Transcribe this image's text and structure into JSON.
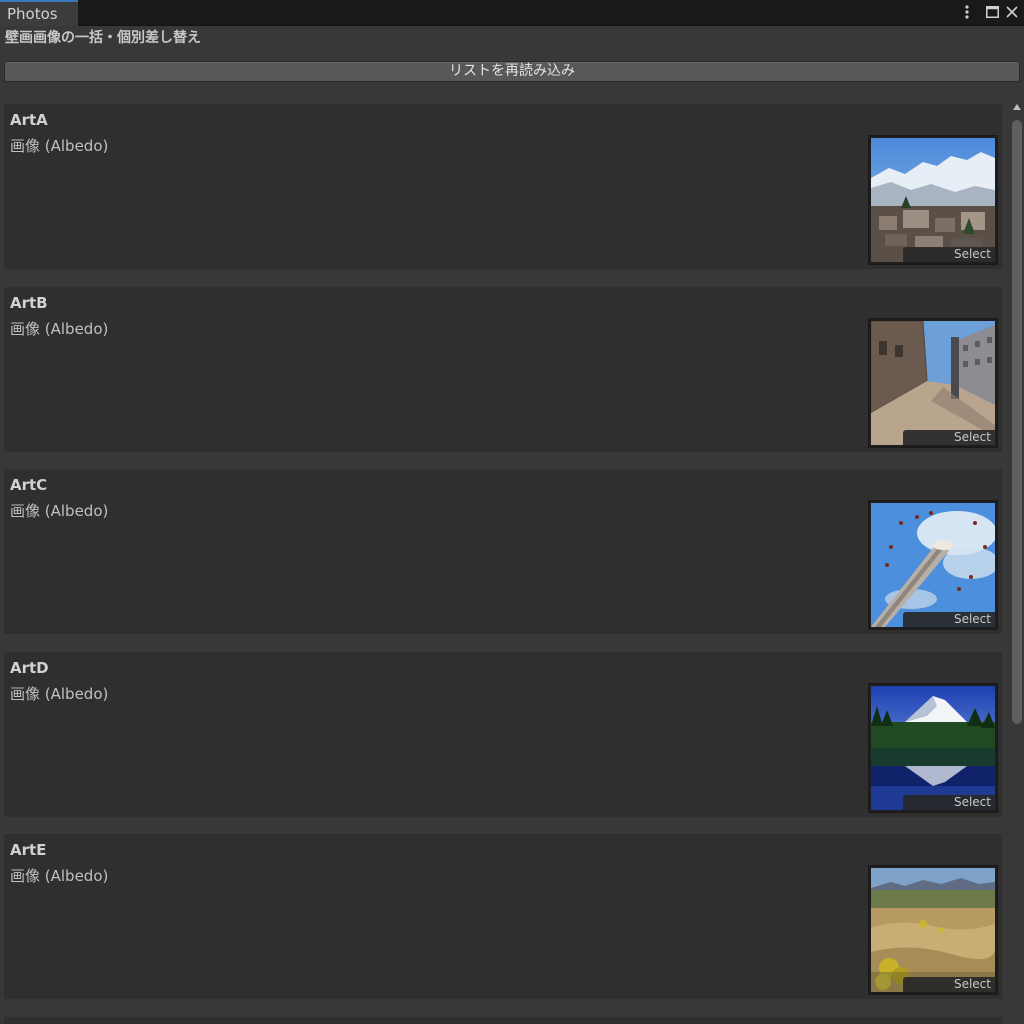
{
  "window": {
    "tab_title": "Photos",
    "heading": "壁画画像の一括・個別差し替え",
    "reload_button": "リストを再読み込み",
    "controls": [
      "kebab-menu-icon",
      "maximize-icon",
      "close-icon"
    ]
  },
  "items": [
    {
      "name": "ArtA",
      "field_label": "画像 (Albedo)",
      "select_label": "Select",
      "thumbnail": "snowy-mountain-village"
    },
    {
      "name": "ArtB",
      "field_label": "画像 (Albedo)",
      "select_label": "Select",
      "thumbnail": "stone-street-courtyard"
    },
    {
      "name": "ArtC",
      "field_label": "画像 (Albedo)",
      "select_label": "Select",
      "thumbnail": "swing-ride-tower"
    },
    {
      "name": "ArtD",
      "field_label": "画像 (Albedo)",
      "select_label": "Select",
      "thumbnail": "mountain-lake-reflection"
    },
    {
      "name": "ArtE",
      "field_label": "画像 (Albedo)",
      "select_label": "Select",
      "thumbnail": "wildflower-meadow"
    }
  ],
  "colors": {
    "background": "#383838",
    "card": "#2f2f2f",
    "tab_accent": "#3a79bb",
    "button": "#585858"
  }
}
